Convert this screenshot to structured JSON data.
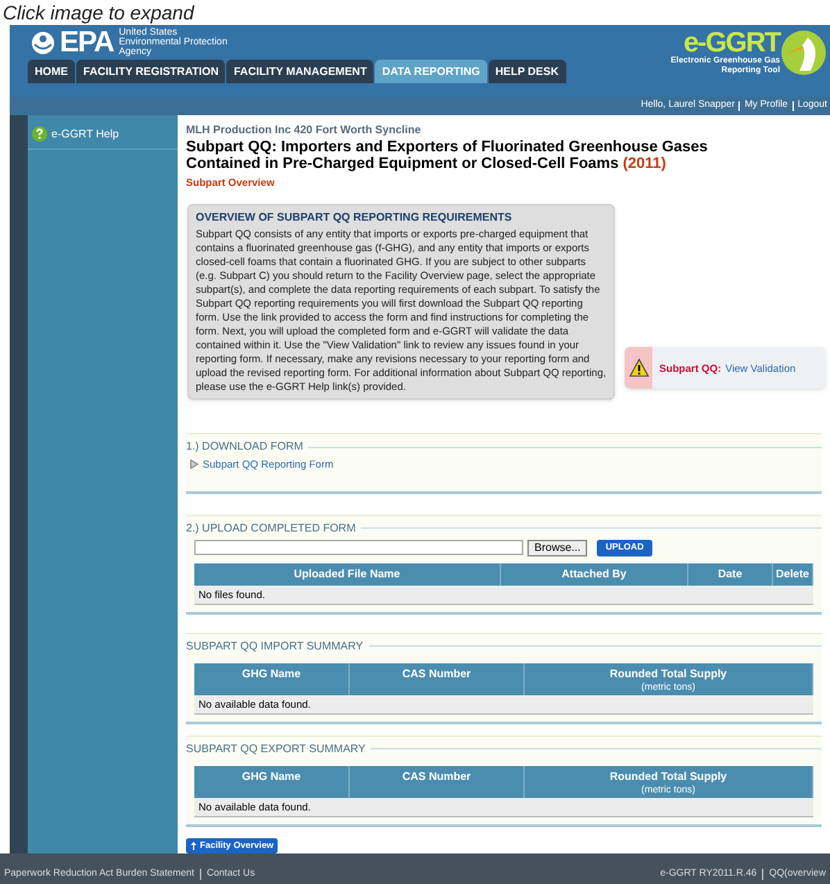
{
  "caption": "Click image to expand",
  "header": {
    "agency_mark": "EPA",
    "agency_name": [
      "United States",
      "Environmental Protection",
      "Agency"
    ],
    "product_name": "e-GGRT",
    "product_full": [
      "Electronic Greenhouse Gas",
      "Reporting Tool"
    ]
  },
  "tabs": [
    {
      "label": "HOME",
      "selected": false
    },
    {
      "label": "FACILITY REGISTRATION",
      "selected": false
    },
    {
      "label": "FACILITY MANAGEMENT",
      "selected": false
    },
    {
      "label": "DATA REPORTING",
      "selected": true
    },
    {
      "label": "HELP DESK",
      "selected": false
    }
  ],
  "user_links": [
    "Hello, Laurel Snapper",
    "My Profile",
    "Logout"
  ],
  "sidebar": {
    "items": [
      "e-GGRT Help"
    ]
  },
  "facility": "MLH Production Inc 420 Fort Worth Syncline",
  "title": "Subpart QQ: Importers and Exporters of Fluorinated Greenhouse Gases Contained in Pre-Charged Equipment or Closed-Cell Foams",
  "year": "(2011)",
  "subtitle": "Subpart Overview",
  "overview": {
    "heading": "OVERVIEW OF SUBPART QQ REPORTING REQUIREMENTS",
    "body": "Subpart QQ consists of any entity that imports or exports pre-charged equipment that contains a fluorinated greenhouse gas (f-GHG), and any entity that imports or exports closed-cell foams that contain a fluorinated GHG. If you are subject to other subparts (e.g. Subpart C) you should return to the Facility Overview page, select the appropriate subpart(s), and complete the data reporting requirements of each subpart. To satisfy the Subpart QQ reporting requirements you will first download the Subpart QQ reporting form. Use the link provided to access the form and find instructions for completing the form. Next, you will upload the completed form and e-GGRT will validate the data contained within it. Use the \"View Validation\" link to review any issues found in your reporting form. If necessary, make any revisions necessary to your reporting form and upload the revised reporting form. For additional information about Subpart QQ reporting, please use the e-GGRT Help link(s) provided."
  },
  "validation": {
    "label": "Subpart QQ:",
    "link": "View Validation"
  },
  "download": {
    "heading": "1.) DOWNLOAD FORM",
    "link": "Subpart QQ Reporting Form"
  },
  "upload": {
    "heading": "2.) UPLOAD COMPLETED FORM",
    "browse": "Browse...",
    "button": "UPLOAD",
    "columns": [
      "Uploaded File Name",
      "Attached By",
      "Date",
      "Delete"
    ],
    "empty": "No files found."
  },
  "summaries": [
    {
      "heading": "SUBPART QQ IMPORT SUMMARY",
      "columns": [
        {
          "label": "GHG Name"
        },
        {
          "label": "CAS Number"
        },
        {
          "label": "Rounded Total Supply",
          "unit": "(metric tons)"
        }
      ],
      "empty": "No available data found."
    },
    {
      "heading": "SUBPART QQ EXPORT SUMMARY",
      "columns": [
        {
          "label": "GHG Name"
        },
        {
          "label": "CAS Number"
        },
        {
          "label": "Rounded Total Supply",
          "unit": "(metric tons)"
        }
      ],
      "empty": "No available data found."
    }
  ],
  "back_button": "Facility Overview",
  "footer": {
    "left": [
      "Paperwork Reduction Act Burden Statement",
      "Contact Us"
    ],
    "right": [
      "e-GGRT RY2011.R.46",
      "QQ(overview"
    ]
  }
}
